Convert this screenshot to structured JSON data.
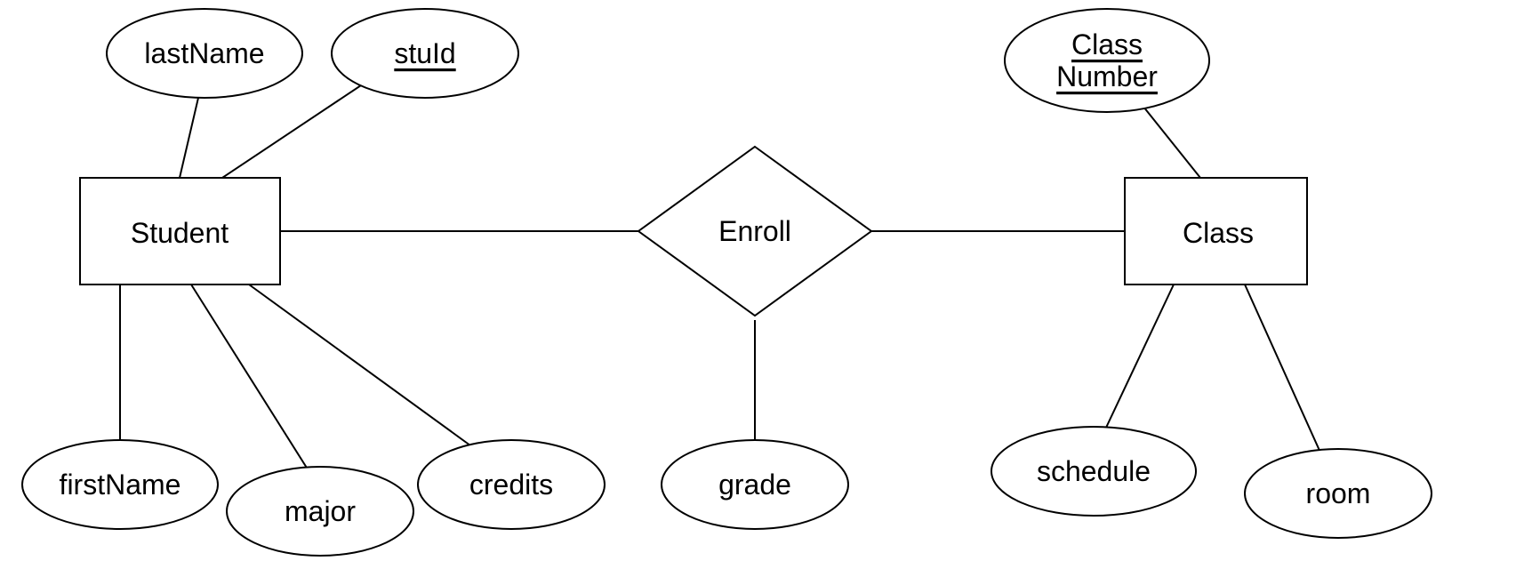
{
  "entities": {
    "student": {
      "label": "Student",
      "attributes": {
        "lastName": "lastName",
        "stuId": "stuId",
        "firstName": "firstName",
        "major": "major",
        "credits": "credits"
      }
    },
    "class": {
      "label": "Class",
      "attributes": {
        "classNumber_line1": "Class",
        "classNumber_line2": "Number",
        "schedule": "schedule",
        "room": "room"
      }
    }
  },
  "relationships": {
    "enroll": {
      "label": "Enroll",
      "attributes": {
        "grade": "grade"
      }
    }
  }
}
